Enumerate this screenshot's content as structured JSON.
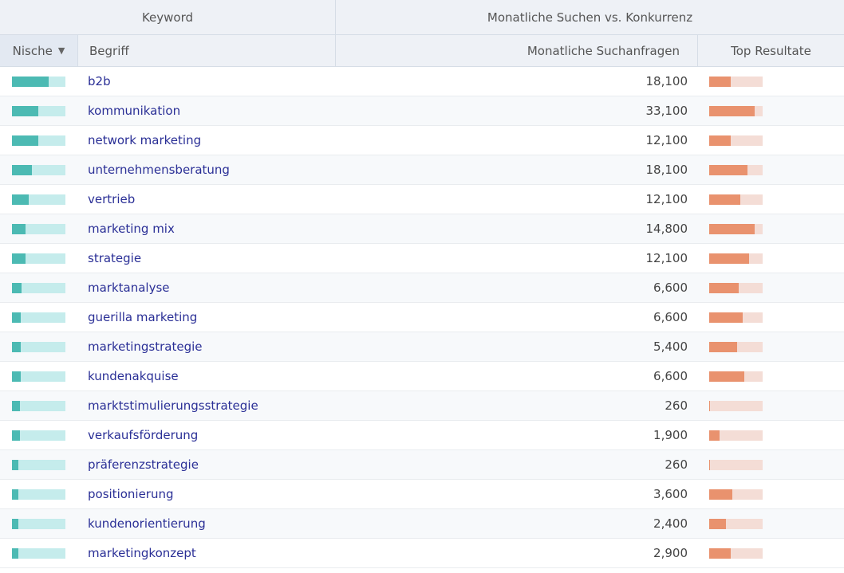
{
  "header": {
    "group_keyword": "Keyword",
    "group_monthly": "Monatliche Suchen vs. Konkurrenz",
    "col_nische": "Nische",
    "col_begriff": "Begriff",
    "col_monthly": "Monatliche Suchanfragen",
    "col_top": "Top Resultate",
    "sort_icon": "triangle-down"
  },
  "colors": {
    "niche_fill": "#4cbab3",
    "niche_bg": "#c5ecec",
    "top_fill": "#e9926e",
    "top_bg": "#f4ddd6",
    "link": "#2a2f96"
  },
  "rows": [
    {
      "term": "b2b",
      "monthly": "18,100",
      "niche": 0.68,
      "top": 0.4
    },
    {
      "term": "kommunikation",
      "monthly": "33,100",
      "niche": 0.49,
      "top": 0.85
    },
    {
      "term": "network marketing",
      "monthly": "12,100",
      "niche": 0.49,
      "top": 0.4
    },
    {
      "term": "unternehmensberatung",
      "monthly": "18,100",
      "niche": 0.38,
      "top": 0.72
    },
    {
      "term": "vertrieb",
      "monthly": "12,100",
      "niche": 0.32,
      "top": 0.58
    },
    {
      "term": "marketing mix",
      "monthly": "14,800",
      "niche": 0.26,
      "top": 0.85
    },
    {
      "term": "strategie",
      "monthly": "12,100",
      "niche": 0.26,
      "top": 0.74
    },
    {
      "term": "marktanalyse",
      "monthly": "6,600",
      "niche": 0.18,
      "top": 0.55
    },
    {
      "term": "guerilla marketing",
      "monthly": "6,600",
      "niche": 0.16,
      "top": 0.63
    },
    {
      "term": "marketingstrategie",
      "monthly": "5,400",
      "niche": 0.16,
      "top": 0.52
    },
    {
      "term": "kundenakquise",
      "monthly": "6,600",
      "niche": 0.16,
      "top": 0.66
    },
    {
      "term": "marktstimulierungsstrategie",
      "monthly": "260",
      "niche": 0.15,
      "top": 0.02
    },
    {
      "term": "verkaufsförderung",
      "monthly": "1,900",
      "niche": 0.15,
      "top": 0.2
    },
    {
      "term": "präferenzstrategie",
      "monthly": "260",
      "niche": 0.12,
      "top": 0.02
    },
    {
      "term": "positionierung",
      "monthly": "3,600",
      "niche": 0.12,
      "top": 0.44
    },
    {
      "term": "kundenorientierung",
      "monthly": "2,400",
      "niche": 0.12,
      "top": 0.32
    },
    {
      "term": "marketingkonzept",
      "monthly": "2,900",
      "niche": 0.12,
      "top": 0.4
    }
  ]
}
